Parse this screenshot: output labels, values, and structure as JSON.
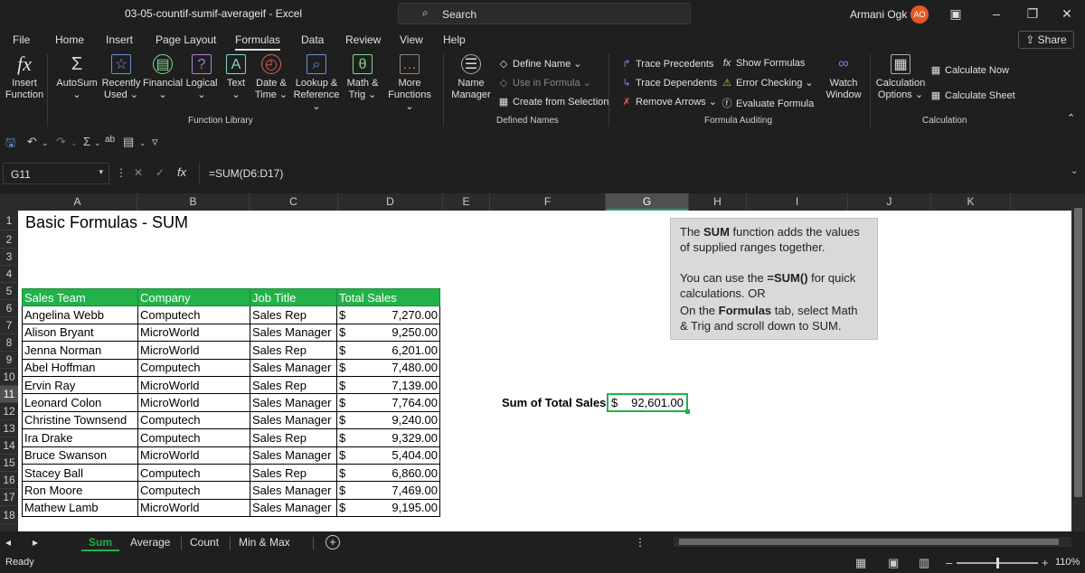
{
  "window": {
    "title": "03-05-countif-sumif-averageif  -  Excel",
    "search_placeholder": "Search",
    "user_name": "Armani Ogk",
    "user_initials": "AO"
  },
  "ribbon_tabs": [
    "File",
    "Home",
    "Insert",
    "Page Layout",
    "Formulas",
    "Data",
    "Review",
    "View",
    "Help"
  ],
  "active_tab": "Formulas",
  "share_label": "Share",
  "ribbon": {
    "insert_function": [
      "Insert",
      "Function"
    ],
    "autosum": "AutoSum",
    "recently_used": [
      "Recently",
      "Used"
    ],
    "financial": "Financial",
    "logical": "Logical",
    "text": "Text",
    "date_time": [
      "Date &",
      "Time"
    ],
    "lookup_reference": [
      "Lookup &",
      "Reference"
    ],
    "math_trig": [
      "Math &",
      "Trig"
    ],
    "more_functions": [
      "More",
      "Functions"
    ],
    "function_library_label": "Function Library",
    "name_manager": [
      "Name",
      "Manager"
    ],
    "define_name": "Define Name",
    "use_in_formula": "Use in Formula",
    "create_from_selection": "Create from Selection",
    "defined_names_label": "Defined Names",
    "trace_precedents": "Trace Precedents",
    "trace_dependents": "Trace Dependents",
    "remove_arrows": "Remove Arrows",
    "show_formulas": "Show Formulas",
    "error_checking": "Error Checking",
    "evaluate_formula": "Evaluate Formula",
    "watch_window": [
      "Watch",
      "Window"
    ],
    "formula_auditing_label": "Formula Auditing",
    "calculation_options": [
      "Calculation",
      "Options"
    ],
    "calculate_now": "Calculate Now",
    "calculate_sheet": "Calculate Sheet",
    "calculation_label": "Calculation"
  },
  "formula_bar": {
    "name_box": "G11",
    "fx": "fx",
    "formula": "=SUM(D6:D17)"
  },
  "columns": [
    "A",
    "B",
    "C",
    "D",
    "E",
    "F",
    "G",
    "H",
    "I",
    "J",
    "K"
  ],
  "selected_column": "G",
  "rows": [
    "1",
    "2",
    "3",
    "4",
    "5",
    "6",
    "7",
    "8",
    "9",
    "10",
    "11",
    "12",
    "13",
    "14",
    "15",
    "16",
    "17",
    "18"
  ],
  "selected_row": "11",
  "sheet": {
    "title": "Basic Formulas - SUM",
    "headers": [
      "Sales Team",
      "Company",
      "Job Title",
      "Total Sales"
    ],
    "records": [
      [
        "Angelina Webb",
        "Computech",
        "Sales Rep",
        "7,270.00"
      ],
      [
        "Alison Bryant",
        "MicroWorld",
        "Sales Manager",
        "9,250.00"
      ],
      [
        "Jenna Norman",
        "MicroWorld",
        "Sales Rep",
        "6,201.00"
      ],
      [
        "Abel Hoffman",
        "Computech",
        "Sales Manager",
        "7,480.00"
      ],
      [
        "Ervin Ray",
        "MicroWorld",
        "Sales Rep",
        "7,139.00"
      ],
      [
        "Leonard Colon",
        "MicroWorld",
        "Sales Manager",
        "7,764.00"
      ],
      [
        "Christine Townsend",
        "Computech",
        "Sales Manager",
        "9,240.00"
      ],
      [
        "Ira Drake",
        "Computech",
        "Sales Rep",
        "9,329.00"
      ],
      [
        "Bruce Swanson",
        "MicroWorld",
        "Sales Manager",
        "5,404.00"
      ],
      [
        "Stacey Ball",
        "Computech",
        "Sales Rep",
        "6,860.00"
      ],
      [
        "Ron Moore",
        "Computech",
        "Sales Manager",
        "7,469.00"
      ],
      [
        "Mathew Lamb",
        "MicroWorld",
        "Sales Manager",
        "9,195.00"
      ]
    ],
    "currency_symbol": "$",
    "sum_label": "Sum of Total Sales",
    "sum_value": "92,601.00"
  },
  "note": {
    "line1_pre": "The ",
    "line1_bold": "SUM",
    "line1_post": " function adds the values of supplied ranges together.",
    "line2_pre": "You can use the ",
    "line2_bold": "=SUM()",
    "line2_post": " for quick calculations. OR",
    "line3_pre": "On the ",
    "line3_bold": "Formulas",
    "line3_post": " tab, select Math & Trig and scroll down to SUM."
  },
  "sheet_tabs": [
    "Sum",
    "Average",
    "Count",
    "Min & Max"
  ],
  "active_sheet": "Sum",
  "status": {
    "text": "Ready",
    "zoom": "110%"
  }
}
